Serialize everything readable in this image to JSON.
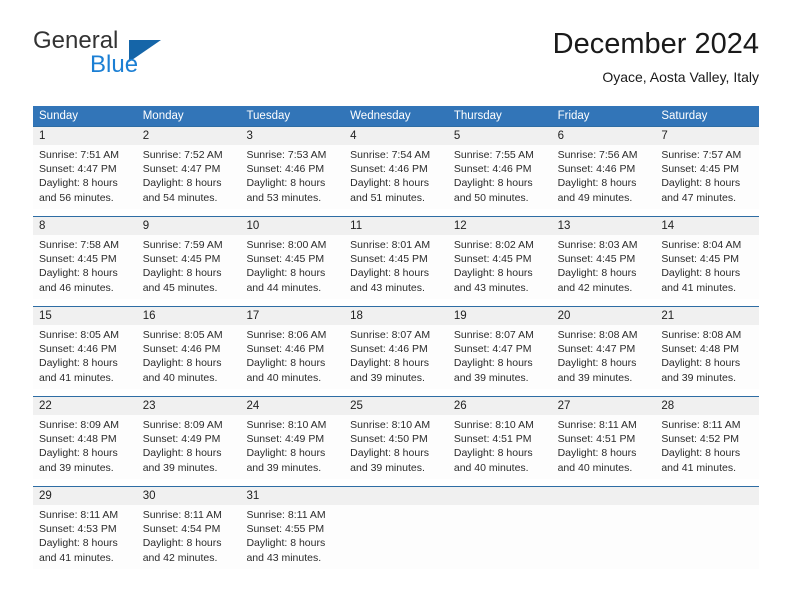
{
  "brand": {
    "name_top": "General",
    "name_bottom": "Blue",
    "triangle_icon": "brand-triangle-icon",
    "color_top": "#333333",
    "color_bottom": "#1b7fd4",
    "color_triangle": "#1565a8"
  },
  "header": {
    "title": "December 2024",
    "subtitle": "Oyace, Aosta Valley, Italy"
  },
  "theme": {
    "header_bg": "#3275b8",
    "header_text": "#ffffff",
    "row_divider": "#2e6da4",
    "daynum_bg": "#f0f0f0",
    "cell_bg": "#fdfdfd",
    "body_text": "#2b2b2b"
  },
  "weekdays": [
    "Sunday",
    "Monday",
    "Tuesday",
    "Wednesday",
    "Thursday",
    "Friday",
    "Saturday"
  ],
  "weeks": [
    [
      {
        "day": "1",
        "lines": [
          "Sunrise: 7:51 AM",
          "Sunset: 4:47 PM",
          "Daylight: 8 hours",
          "and 56 minutes."
        ]
      },
      {
        "day": "2",
        "lines": [
          "Sunrise: 7:52 AM",
          "Sunset: 4:47 PM",
          "Daylight: 8 hours",
          "and 54 minutes."
        ]
      },
      {
        "day": "3",
        "lines": [
          "Sunrise: 7:53 AM",
          "Sunset: 4:46 PM",
          "Daylight: 8 hours",
          "and 53 minutes."
        ]
      },
      {
        "day": "4",
        "lines": [
          "Sunrise: 7:54 AM",
          "Sunset: 4:46 PM",
          "Daylight: 8 hours",
          "and 51 minutes."
        ]
      },
      {
        "day": "5",
        "lines": [
          "Sunrise: 7:55 AM",
          "Sunset: 4:46 PM",
          "Daylight: 8 hours",
          "and 50 minutes."
        ]
      },
      {
        "day": "6",
        "lines": [
          "Sunrise: 7:56 AM",
          "Sunset: 4:46 PM",
          "Daylight: 8 hours",
          "and 49 minutes."
        ]
      },
      {
        "day": "7",
        "lines": [
          "Sunrise: 7:57 AM",
          "Sunset: 4:45 PM",
          "Daylight: 8 hours",
          "and 47 minutes."
        ]
      }
    ],
    [
      {
        "day": "8",
        "lines": [
          "Sunrise: 7:58 AM",
          "Sunset: 4:45 PM",
          "Daylight: 8 hours",
          "and 46 minutes."
        ]
      },
      {
        "day": "9",
        "lines": [
          "Sunrise: 7:59 AM",
          "Sunset: 4:45 PM",
          "Daylight: 8 hours",
          "and 45 minutes."
        ]
      },
      {
        "day": "10",
        "lines": [
          "Sunrise: 8:00 AM",
          "Sunset: 4:45 PM",
          "Daylight: 8 hours",
          "and 44 minutes."
        ]
      },
      {
        "day": "11",
        "lines": [
          "Sunrise: 8:01 AM",
          "Sunset: 4:45 PM",
          "Daylight: 8 hours",
          "and 43 minutes."
        ]
      },
      {
        "day": "12",
        "lines": [
          "Sunrise: 8:02 AM",
          "Sunset: 4:45 PM",
          "Daylight: 8 hours",
          "and 43 minutes."
        ]
      },
      {
        "day": "13",
        "lines": [
          "Sunrise: 8:03 AM",
          "Sunset: 4:45 PM",
          "Daylight: 8 hours",
          "and 42 minutes."
        ]
      },
      {
        "day": "14",
        "lines": [
          "Sunrise: 8:04 AM",
          "Sunset: 4:45 PM",
          "Daylight: 8 hours",
          "and 41 minutes."
        ]
      }
    ],
    [
      {
        "day": "15",
        "lines": [
          "Sunrise: 8:05 AM",
          "Sunset: 4:46 PM",
          "Daylight: 8 hours",
          "and 41 minutes."
        ]
      },
      {
        "day": "16",
        "lines": [
          "Sunrise: 8:05 AM",
          "Sunset: 4:46 PM",
          "Daylight: 8 hours",
          "and 40 minutes."
        ]
      },
      {
        "day": "17",
        "lines": [
          "Sunrise: 8:06 AM",
          "Sunset: 4:46 PM",
          "Daylight: 8 hours",
          "and 40 minutes."
        ]
      },
      {
        "day": "18",
        "lines": [
          "Sunrise: 8:07 AM",
          "Sunset: 4:46 PM",
          "Daylight: 8 hours",
          "and 39 minutes."
        ]
      },
      {
        "day": "19",
        "lines": [
          "Sunrise: 8:07 AM",
          "Sunset: 4:47 PM",
          "Daylight: 8 hours",
          "and 39 minutes."
        ]
      },
      {
        "day": "20",
        "lines": [
          "Sunrise: 8:08 AM",
          "Sunset: 4:47 PM",
          "Daylight: 8 hours",
          "and 39 minutes."
        ]
      },
      {
        "day": "21",
        "lines": [
          "Sunrise: 8:08 AM",
          "Sunset: 4:48 PM",
          "Daylight: 8 hours",
          "and 39 minutes."
        ]
      }
    ],
    [
      {
        "day": "22",
        "lines": [
          "Sunrise: 8:09 AM",
          "Sunset: 4:48 PM",
          "Daylight: 8 hours",
          "and 39 minutes."
        ]
      },
      {
        "day": "23",
        "lines": [
          "Sunrise: 8:09 AM",
          "Sunset: 4:49 PM",
          "Daylight: 8 hours",
          "and 39 minutes."
        ]
      },
      {
        "day": "24",
        "lines": [
          "Sunrise: 8:10 AM",
          "Sunset: 4:49 PM",
          "Daylight: 8 hours",
          "and 39 minutes."
        ]
      },
      {
        "day": "25",
        "lines": [
          "Sunrise: 8:10 AM",
          "Sunset: 4:50 PM",
          "Daylight: 8 hours",
          "and 39 minutes."
        ]
      },
      {
        "day": "26",
        "lines": [
          "Sunrise: 8:10 AM",
          "Sunset: 4:51 PM",
          "Daylight: 8 hours",
          "and 40 minutes."
        ]
      },
      {
        "day": "27",
        "lines": [
          "Sunrise: 8:11 AM",
          "Sunset: 4:51 PM",
          "Daylight: 8 hours",
          "and 40 minutes."
        ]
      },
      {
        "day": "28",
        "lines": [
          "Sunrise: 8:11 AM",
          "Sunset: 4:52 PM",
          "Daylight: 8 hours",
          "and 41 minutes."
        ]
      }
    ],
    [
      {
        "day": "29",
        "lines": [
          "Sunrise: 8:11 AM",
          "Sunset: 4:53 PM",
          "Daylight: 8 hours",
          "and 41 minutes."
        ]
      },
      {
        "day": "30",
        "lines": [
          "Sunrise: 8:11 AM",
          "Sunset: 4:54 PM",
          "Daylight: 8 hours",
          "and 42 minutes."
        ]
      },
      {
        "day": "31",
        "lines": [
          "Sunrise: 8:11 AM",
          "Sunset: 4:55 PM",
          "Daylight: 8 hours",
          "and 43 minutes."
        ]
      },
      {
        "day": "",
        "lines": []
      },
      {
        "day": "",
        "lines": []
      },
      {
        "day": "",
        "lines": []
      },
      {
        "day": "",
        "lines": []
      }
    ]
  ]
}
